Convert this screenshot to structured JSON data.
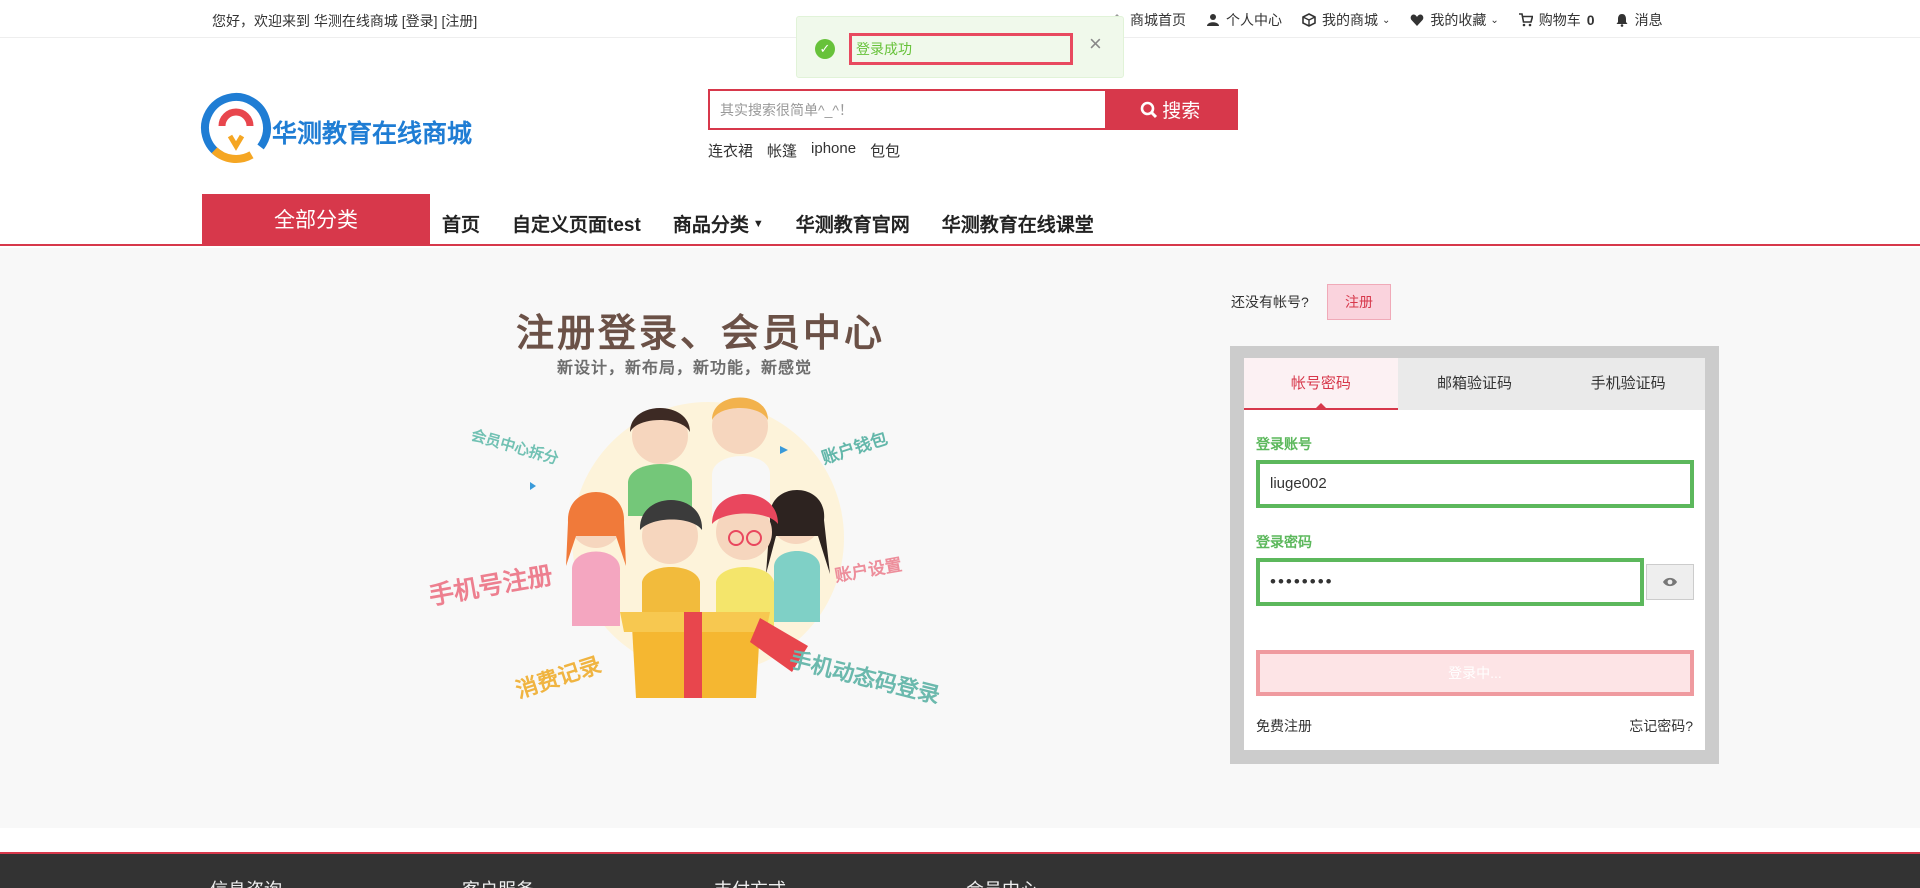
{
  "topbar": {
    "greeting": "您好，欢迎来到 华测在线商城",
    "login_link": "[登录]",
    "register_link": "[注册]",
    "nav": [
      {
        "label": "商城首页",
        "icon": "home-icon"
      },
      {
        "label": "个人中心",
        "icon": "user-icon"
      },
      {
        "label": "我的商城",
        "icon": "cube-icon"
      },
      {
        "label": "我的收藏",
        "icon": "heart-icon"
      },
      {
        "label": "购物车",
        "icon": "cart-icon",
        "count": "0"
      },
      {
        "label": "消息",
        "icon": "bell-icon"
      }
    ]
  },
  "toast": {
    "message": "登录成功",
    "icon": "check-circle-icon",
    "close": "×"
  },
  "header": {
    "logo_text": "华测教育在线商城",
    "search": {
      "placeholder": "其实搜索很简单^_^！",
      "button_label": "搜索"
    },
    "hot_words": [
      "连衣裙",
      "帐篷",
      "iphone",
      "包包"
    ]
  },
  "nav": {
    "all_categories": "全部分类",
    "items": [
      "首页",
      "自定义页面test",
      "商品分类",
      "华测教育官网",
      "华测教育在线课堂"
    ]
  },
  "banner": {
    "title": "注册登录、会员中心",
    "subtitle": "新设计，新布局，新功能，新感觉",
    "labels": [
      "会员中心拆分",
      "账户钱包",
      "手机号注册",
      "账户设置",
      "消费记录",
      "手机动态码登录"
    ]
  },
  "login": {
    "no_account": "还没有帐号?",
    "register_button": "注册",
    "tabs": [
      "帐号密码",
      "邮箱验证码",
      "手机验证码"
    ],
    "active_tab": 0,
    "account_label": "登录账号",
    "account_value": "liuge002",
    "password_label": "登录密码",
    "password_value": "••••••••",
    "submit_label": "登录中...",
    "free_register": "免费注册",
    "forgot_password": "忘记密码?"
  },
  "footer": {
    "sections": [
      "信息咨询",
      "客户服务",
      "支付方式",
      "会员中心"
    ]
  },
  "colors": {
    "brand_red": "#d7384b",
    "success_green": "#5cb85c",
    "logo_blue": "#1f7dd4"
  }
}
